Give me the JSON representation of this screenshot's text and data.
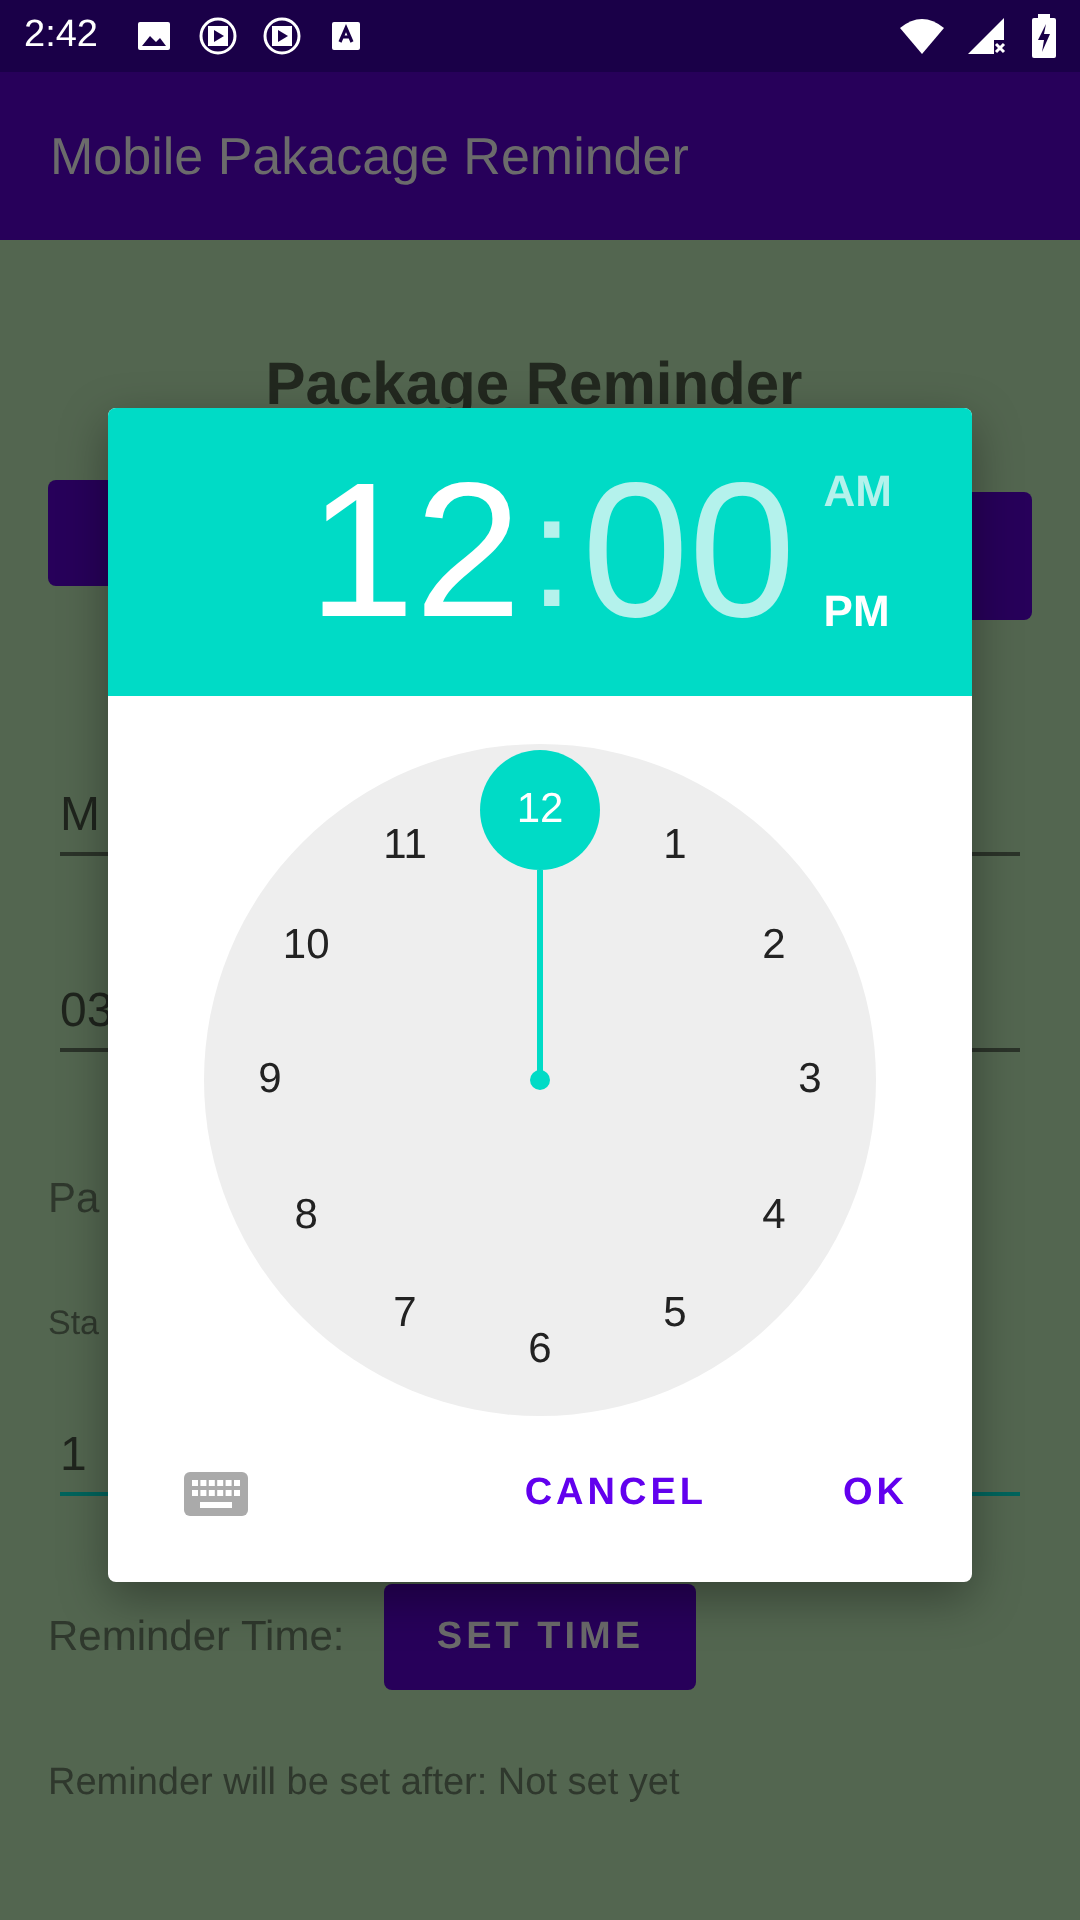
{
  "status_bar": {
    "time": "2:42"
  },
  "app_bar": {
    "title": "Mobile Pakacage Reminder"
  },
  "page": {
    "heading": "Package Reminder",
    "fields": [
      {
        "value": "M",
        "focused": false
      },
      {
        "value": "03",
        "focused": false
      }
    ],
    "label": "Pa",
    "hint": "Sta",
    "quantity_field": {
      "value": "1",
      "focused": true
    },
    "reminder_label": "Reminder Time:",
    "set_time_button": "SET TIME",
    "status_text": "Reminder will be set after: Not set yet"
  },
  "time_picker": {
    "hour": {
      "text": "12",
      "selected": true
    },
    "separator": ":",
    "minute": {
      "text": "00",
      "selected": false
    },
    "periods": [
      {
        "label": "AM",
        "selected": false
      },
      {
        "label": "PM",
        "selected": true
      }
    ],
    "dial": [
      {
        "label": "12",
        "selected": true
      },
      {
        "label": "1",
        "selected": false
      },
      {
        "label": "2",
        "selected": false
      },
      {
        "label": "3",
        "selected": false
      },
      {
        "label": "4",
        "selected": false
      },
      {
        "label": "5",
        "selected": false
      },
      {
        "label": "6",
        "selected": false
      },
      {
        "label": "7",
        "selected": false
      },
      {
        "label": "8",
        "selected": false
      },
      {
        "label": "9",
        "selected": false
      },
      {
        "label": "10",
        "selected": false
      },
      {
        "label": "11",
        "selected": false
      }
    ],
    "buttons": [
      "CANCEL",
      "OK"
    ]
  }
}
